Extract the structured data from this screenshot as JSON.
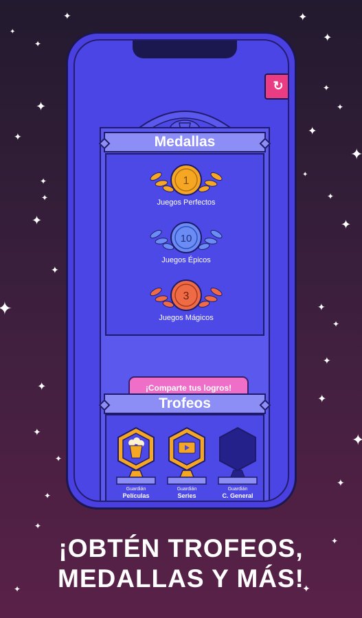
{
  "medals": {
    "title": "Medallas",
    "items": [
      {
        "count": "1",
        "label": "Juegos Perfectos",
        "color": "#f5a623"
      },
      {
        "count": "10",
        "label": "Juegos Épicos",
        "color": "#6a8cf4"
      },
      {
        "count": "3",
        "label": "Juegos Mágicos",
        "color": "#ee6b45"
      }
    ]
  },
  "share_button": "¡Comparte tus logros!",
  "trophies": {
    "title": "Trofeos",
    "items": [
      {
        "small": "Guardián",
        "label": "Películas",
        "icon": "popcorn-icon"
      },
      {
        "small": "Guardián",
        "label": "Series",
        "icon": "tv-icon"
      },
      {
        "small": "Guardián",
        "label": "C. General",
        "icon": "locked-trophy-icon"
      }
    ]
  },
  "headline": {
    "line1": "¡OBTÉN TROFEOS,",
    "line2": "MEDALLAS Y MÁS!"
  },
  "colors": {
    "accent_pink": "#ea3c83",
    "phone_blue": "#4b45e6",
    "gold": "#f5a623"
  }
}
